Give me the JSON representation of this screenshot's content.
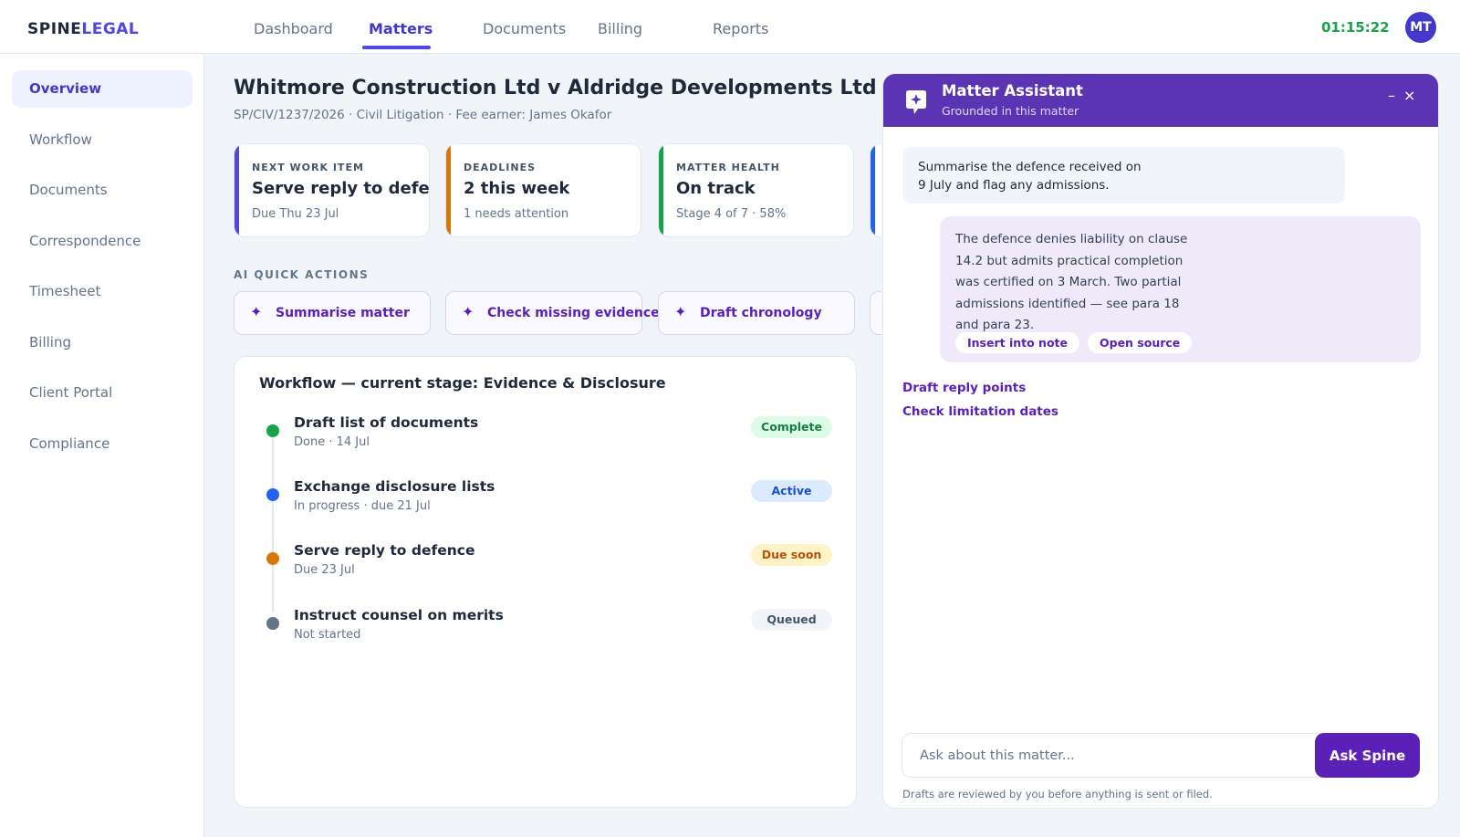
{
  "header": {
    "logo_part1": "SPINE",
    "logo_part2": "LEGAL",
    "nav": [
      "Dashboard",
      "Matters",
      "Documents",
      "Billing",
      "Reports"
    ],
    "active_nav": "Matters",
    "timer": "01:15:22",
    "avatar_initials": "MT"
  },
  "sidebar": {
    "items": [
      "Overview",
      "Workflow",
      "Documents",
      "Correspondence",
      "Timesheet",
      "Billing",
      "Client Portal",
      "Compliance"
    ],
    "active": "Overview"
  },
  "matter": {
    "title": "Whitmore Construction Ltd v Aldridge Developments Ltd",
    "subtitle": "SP/CIV/1237/2026 · Civil Litigation · Fee earner: James Okafor"
  },
  "cards": [
    {
      "label": "NEXT WORK ITEM",
      "value": "Serve reply to defence",
      "meta": "Due Thu 23 Jul",
      "color": "#4f46e5"
    },
    {
      "label": "DEADLINES",
      "value": "2 this week",
      "meta": "1 needs attention",
      "color": "#d97706"
    },
    {
      "label": "MATTER HEALTH",
      "value": "On track",
      "meta": "Stage 4 of 7 · 58%",
      "color": "#16a34a"
    },
    {
      "label": "",
      "value": "",
      "meta": "",
      "color": "#2563eb"
    }
  ],
  "ai_quick_actions": {
    "label": "AI QUICK ACTIONS",
    "actions": [
      "Summarise matter",
      "Check missing evidence",
      "Draft chronology",
      ""
    ]
  },
  "workflow": {
    "title": "Workflow — current stage: Evidence & Disclosure",
    "steps": [
      {
        "title": "Draft list of documents",
        "sub": "Done · 14 Jul",
        "status": "Complete",
        "dot": "#16a34a",
        "badge_bg": "#dcfce7",
        "badge_fg": "#15803d"
      },
      {
        "title": "Exchange disclosure lists",
        "sub": "In progress · due 21 Jul",
        "status": "Active",
        "dot": "#2563eb",
        "badge_bg": "#dbeafe",
        "badge_fg": "#1d4ed8"
      },
      {
        "title": "Serve reply to defence",
        "sub": "Due 23 Jul",
        "status": "Due soon",
        "dot": "#d97706",
        "badge_bg": "#fef3c7",
        "badge_fg": "#b45309"
      },
      {
        "title": "Instruct counsel on merits",
        "sub": "Not started",
        "status": "Queued",
        "dot": "#64748b",
        "badge_bg": "#f1f5f9",
        "badge_fg": "#475569"
      }
    ]
  },
  "assistant": {
    "title": "Matter Assistant",
    "subtitle": "Grounded in this matter",
    "minimize": "–",
    "close": "×",
    "user_message_line1": "Summarise the defence received on",
    "user_message_line2": "9 July and flag any admissions.",
    "ai_message_lines": [
      "The defence denies liability on clause",
      "14.2 but admits practical completion",
      "was certified on 3 March. Two partial",
      "admissions identified — see para 18",
      "and para 23."
    ],
    "chips": [
      "Insert into note",
      "Open source"
    ],
    "suggestions": [
      "Draft reply points",
      "Check limitation dates"
    ],
    "input_placeholder": "Ask about this matter...",
    "send_label": "Ask Spine",
    "footer_note": "Drafts are reviewed by you before anything is sent or filed."
  },
  "colors": {
    "brand": "#4f46e5",
    "assistant_header": "#5b34b4",
    "assistant_accent": "#5b21b6",
    "timer": "#16a34a"
  }
}
